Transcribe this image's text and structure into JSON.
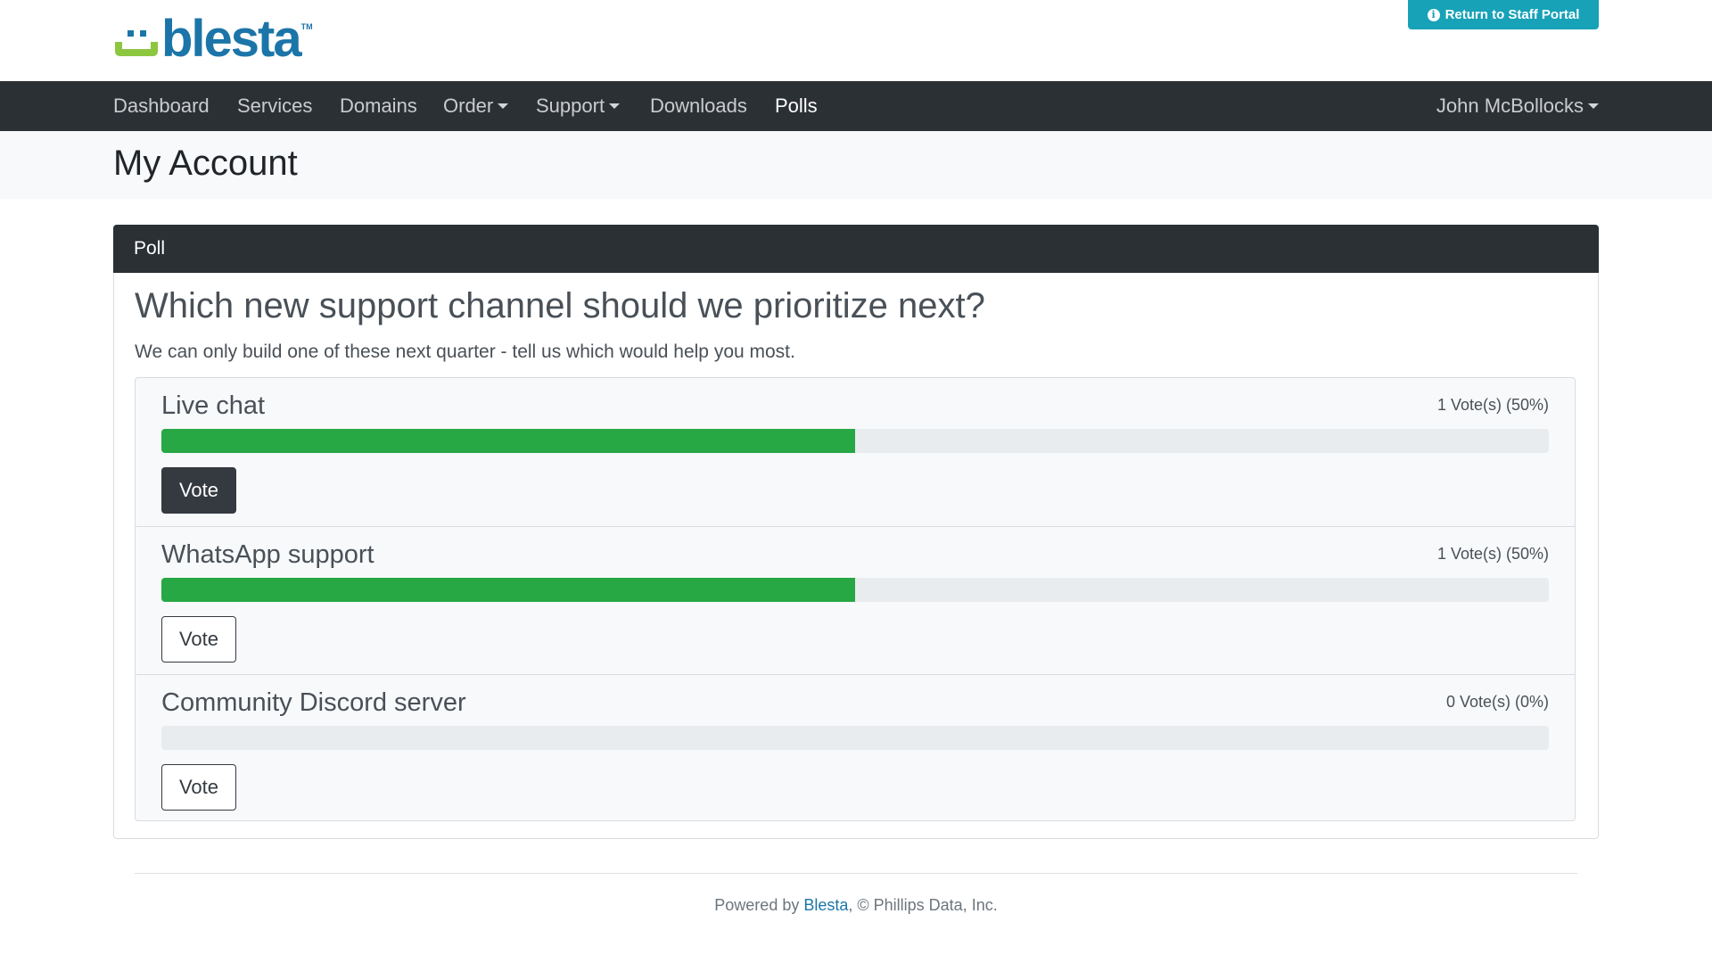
{
  "header": {
    "logo_text": "blesta",
    "logo_tm": "TM",
    "staff_portal_label": "Return to Staff Portal"
  },
  "nav": {
    "items": [
      {
        "label": "Dashboard",
        "dropdown": false,
        "active": false
      },
      {
        "label": "Services",
        "dropdown": false,
        "active": false
      },
      {
        "label": "Domains",
        "dropdown": false,
        "active": false
      },
      {
        "label": "Order",
        "dropdown": true,
        "active": false
      },
      {
        "label": "Support",
        "dropdown": true,
        "active": false
      },
      {
        "label": "Downloads",
        "dropdown": false,
        "active": false
      },
      {
        "label": "Polls",
        "dropdown": false,
        "active": true
      }
    ],
    "user": "John McBollocks"
  },
  "page": {
    "title": "My Account"
  },
  "poll": {
    "card_title": "Poll",
    "question": "Which new support channel should we prioritize next?",
    "description": "We can only build one of these next quarter - tell us which would help you most.",
    "options": [
      {
        "label": "Live chat",
        "votes_text": "1 Vote(s) (50%)",
        "percent": 50,
        "button": "Vote",
        "selected": true
      },
      {
        "label": "WhatsApp support",
        "votes_text": "1 Vote(s) (50%)",
        "percent": 50,
        "button": "Vote",
        "selected": false
      },
      {
        "label": "Community Discord server",
        "votes_text": "0 Vote(s) (0%)",
        "percent": 0,
        "button": "Vote",
        "selected": false
      }
    ]
  },
  "footer": {
    "prefix": "Powered by ",
    "link": "Blesta",
    "suffix": ", © Phillips Data, Inc."
  },
  "colors": {
    "brand": "#1b75a8",
    "nav_bg": "#2b3035",
    "info": "#17a2b8",
    "progress": "#28a745",
    "logo_green": "#8dc63f"
  }
}
